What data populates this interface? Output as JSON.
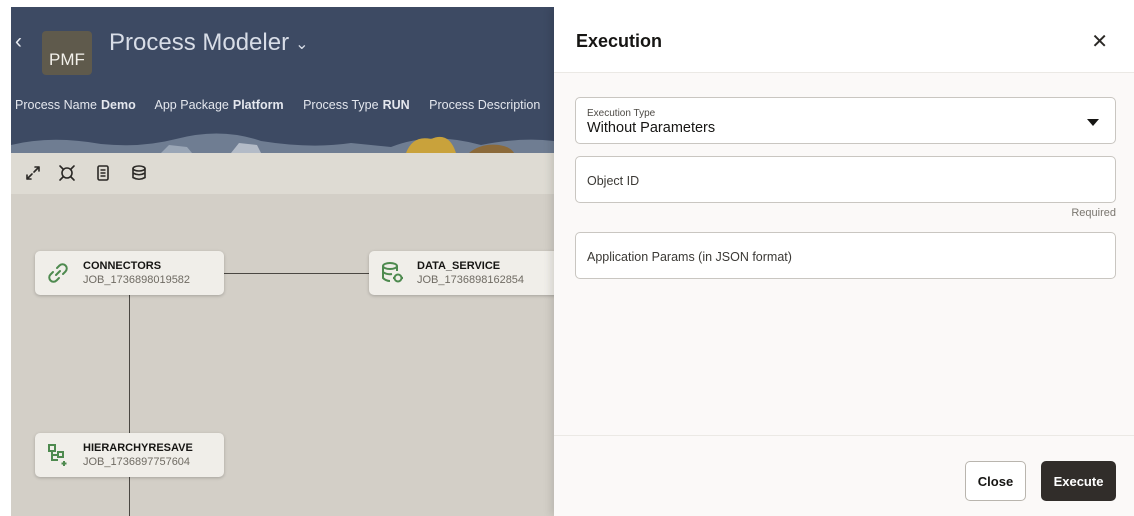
{
  "app": {
    "back_glyph": "‹",
    "logo_text": "PMF",
    "title": "Process Modeler",
    "title_chevron": "⌄",
    "meta": [
      {
        "key": "Process Name",
        "value": "Demo"
      },
      {
        "key": "App Package",
        "value": "Platform"
      },
      {
        "key": "Process Type",
        "value": "RUN"
      },
      {
        "key": "Process Description",
        "value": ""
      }
    ],
    "toolbar_icons": [
      "expand-icon",
      "fit-view-icon",
      "document-icon",
      "database-icon"
    ],
    "nodes": [
      {
        "name": "CONNECTORS",
        "job": "JOB_1736898019582",
        "icon": "link-icon"
      },
      {
        "name": "DATA_SERVICE",
        "job": "JOB_1736898162854",
        "icon": "database-service-icon"
      },
      {
        "name": "HIERARCHYRESAVE",
        "job": "JOB_1736897757604",
        "icon": "hierarchy-icon"
      }
    ],
    "colors": {
      "header_bg": "#3d4a63",
      "canvas_bg": "#d3cfc7",
      "node_icon": "#4e8a4f"
    }
  },
  "drawer": {
    "title": "Execution",
    "close_glyph": "✕",
    "execution_type": {
      "label": "Execution Type",
      "value": "Without Parameters"
    },
    "object_id": {
      "placeholder": "Object ID",
      "help": "Required"
    },
    "app_params": {
      "placeholder": "Application Params (in JSON format)"
    },
    "buttons": {
      "close": "Close",
      "execute": "Execute"
    },
    "colors": {
      "primary_button": "#312d2a"
    }
  }
}
